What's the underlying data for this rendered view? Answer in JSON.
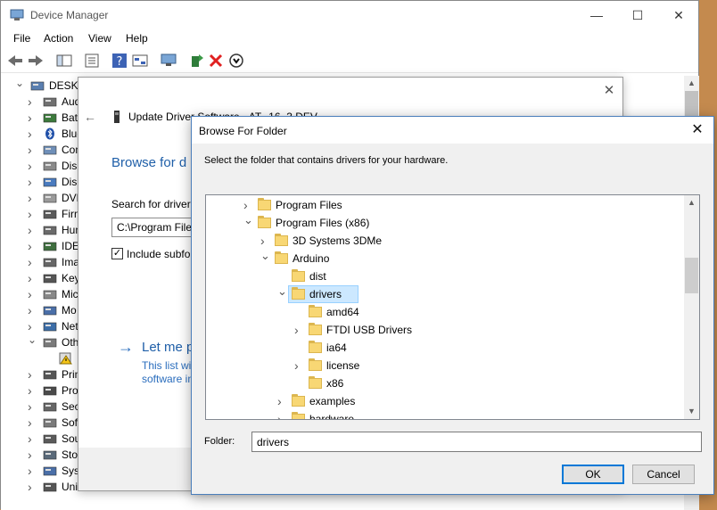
{
  "device_manager": {
    "title": "Device Manager",
    "menu": [
      "File",
      "Action",
      "View",
      "Help"
    ],
    "caption_buttons": {
      "minimize": "—",
      "maximize": "☐",
      "close": "✕"
    },
    "tree": [
      {
        "label": "DESKTO",
        "icon": "computer-icon",
        "expanded": true
      },
      {
        "label": "Aud",
        "icon": "speaker-icon"
      },
      {
        "label": "Batt",
        "icon": "battery-icon"
      },
      {
        "label": "Blue",
        "icon": "bluetooth-icon"
      },
      {
        "label": "Com",
        "icon": "computer-icon"
      },
      {
        "label": "Disk",
        "icon": "disk-drive-icon"
      },
      {
        "label": "Disp",
        "icon": "display-adapter-icon"
      },
      {
        "label": "DVD",
        "icon": "dvd-drive-icon"
      },
      {
        "label": "Firm",
        "icon": "firmware-icon"
      },
      {
        "label": "Hum",
        "icon": "hid-icon"
      },
      {
        "label": "IDE",
        "icon": "ide-controller-icon"
      },
      {
        "label": "Ima",
        "icon": "imaging-device-icon"
      },
      {
        "label": "Key",
        "icon": "keyboard-icon"
      },
      {
        "label": "Mic",
        "icon": "mouse-icon"
      },
      {
        "label": "Mo",
        "icon": "monitor-icon"
      },
      {
        "label": "Net",
        "icon": "network-adapter-icon"
      },
      {
        "label": "Oth",
        "icon": "other-devices-icon",
        "expanded": true
      },
      {
        "label": "",
        "icon": "unknown-device-warning-icon"
      },
      {
        "label": "Prin",
        "icon": "print-queue-icon"
      },
      {
        "label": "Pro",
        "icon": "processor-icon"
      },
      {
        "label": "Sec",
        "icon": "security-device-icon"
      },
      {
        "label": "Soft",
        "icon": "software-device-icon"
      },
      {
        "label": "Sou",
        "icon": "sound-icon"
      },
      {
        "label": "Stor",
        "icon": "storage-controller-icon"
      },
      {
        "label": "Syst",
        "icon": "system-devices-icon"
      },
      {
        "label": "Universal Serial Bus controll",
        "icon": "usb-icon"
      }
    ]
  },
  "update_driver": {
    "header": "Update Driver Software - AT",
    "header_tail": "16_3 DEV",
    "heading": "Browse for d",
    "search_label": "Search for driver",
    "path_value": "C:\\Program File",
    "include_subfolders_label": "Include subfo",
    "include_subfolders_checked": true,
    "let_me_pick": "Let me p",
    "desc_line1": "This list wi",
    "desc_line2": "software in"
  },
  "browse_folder": {
    "title": "Browse For Folder",
    "instruction": "Select the folder that contains drivers for your hardware.",
    "tree": [
      {
        "label": "Program Files",
        "level": 0,
        "chevron": "right"
      },
      {
        "label": "Program Files (x86)",
        "level": 0,
        "chevron": "down"
      },
      {
        "label": "3D Systems 3DMe",
        "level": 1,
        "chevron": "right"
      },
      {
        "label": "Arduino",
        "level": 1,
        "chevron": "down"
      },
      {
        "label": "dist",
        "level": 2,
        "chevron": ""
      },
      {
        "label": "drivers",
        "level": 2,
        "chevron": "down",
        "selected": true
      },
      {
        "label": "amd64",
        "level": 3,
        "chevron": ""
      },
      {
        "label": "FTDI USB Drivers",
        "level": 3,
        "chevron": "right"
      },
      {
        "label": "ia64",
        "level": 3,
        "chevron": ""
      },
      {
        "label": "license",
        "level": 3,
        "chevron": "right"
      },
      {
        "label": "x86",
        "level": 3,
        "chevron": ""
      },
      {
        "label": "examples",
        "level": 2,
        "chevron": "right"
      },
      {
        "label": "hardware",
        "level": 2,
        "chevron": "right"
      }
    ],
    "folder_label": "Folder:",
    "folder_value": "drivers",
    "ok_label": "OK",
    "cancel_label": "Cancel"
  },
  "colors": {
    "selection_bg": "#cce8ff",
    "link_blue": "#1f5fa8",
    "folder_yellow": "#f8d774",
    "focus_border": "#0078d7"
  }
}
